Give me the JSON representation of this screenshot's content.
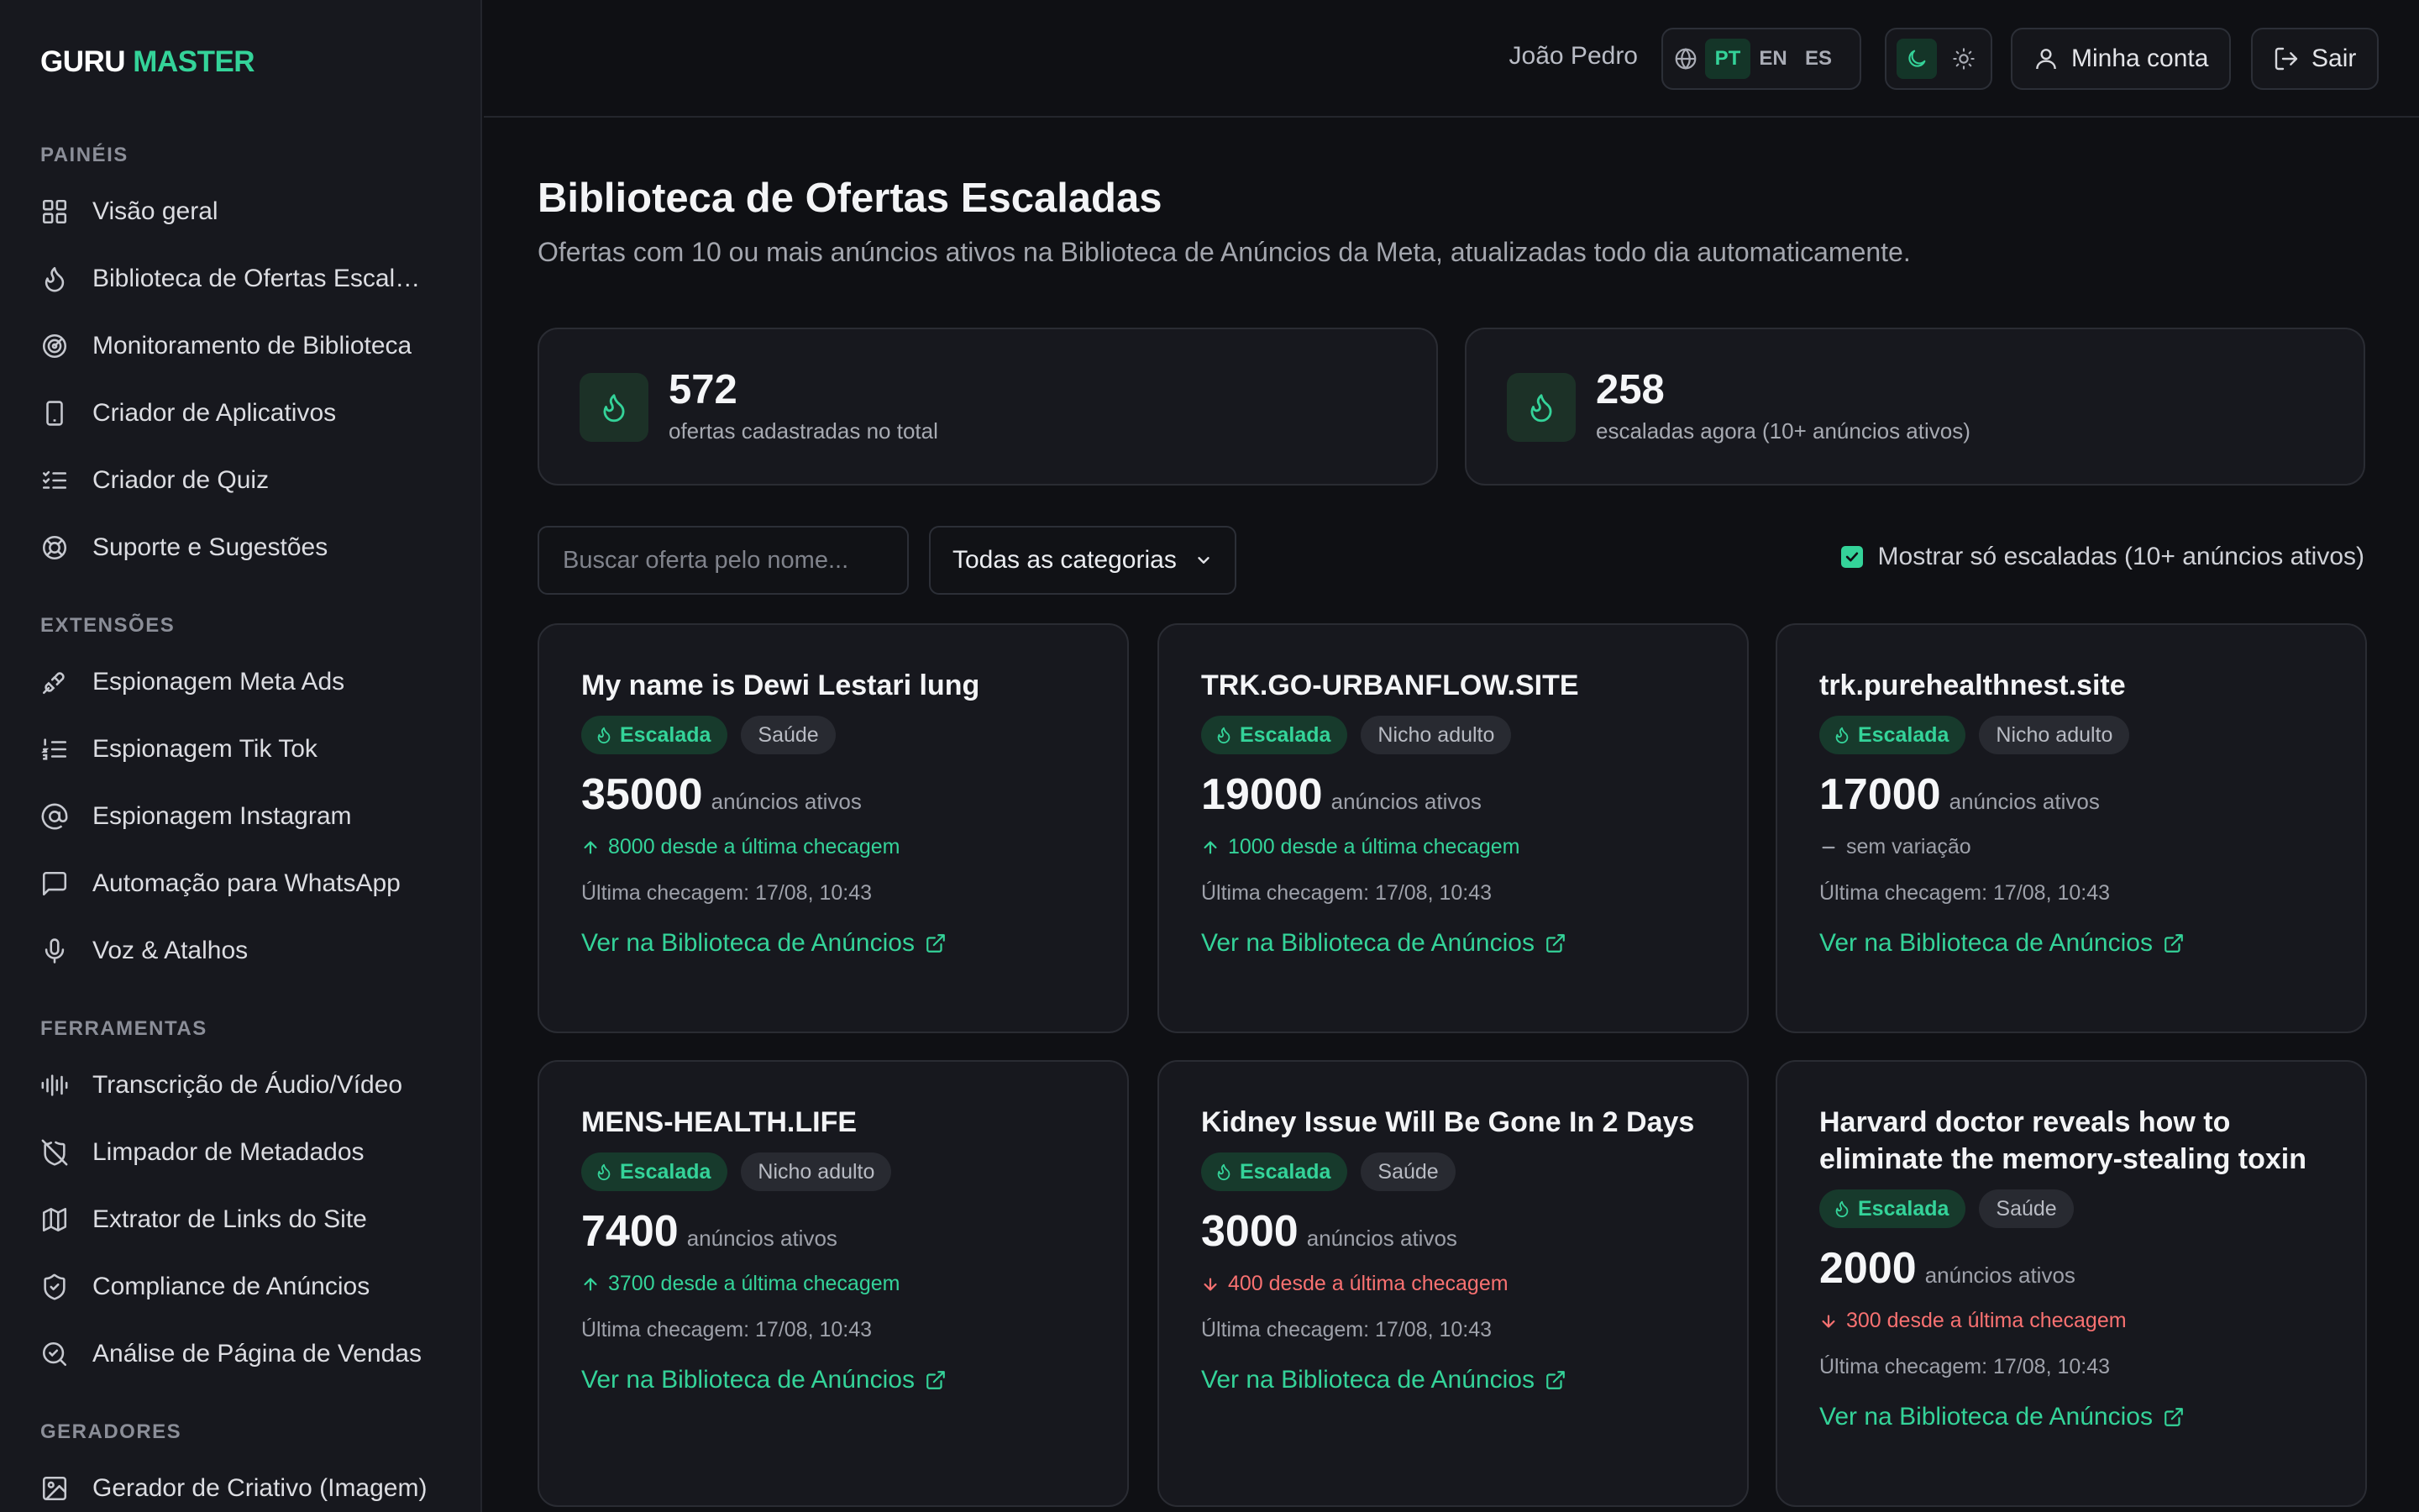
{
  "brand": {
    "part1": "GURU",
    "part2": "MASTER"
  },
  "sidebar": {
    "sections": [
      {
        "title": "PAINÉIS",
        "items": [
          {
            "label": "Visão geral",
            "icon": "grid-icon"
          },
          {
            "label": "Biblioteca de Ofertas Escaladas",
            "icon": "flame-icon"
          },
          {
            "label": "Monitoramento de Biblioteca",
            "icon": "radar-icon"
          },
          {
            "label": "Criador de Aplicativos",
            "icon": "smartphone-icon"
          },
          {
            "label": "Criador de Quiz",
            "icon": "list-checks-icon"
          },
          {
            "label": "Suporte e Sugestões",
            "icon": "lifebuoy-icon"
          }
        ]
      },
      {
        "title": "EXTENSÕES",
        "items": [
          {
            "label": "Espionagem Meta Ads",
            "icon": "plug-icon"
          },
          {
            "label": "Espionagem Tik Tok",
            "icon": "list-ordered-icon"
          },
          {
            "label": "Espionagem Instagram",
            "icon": "at-sign-icon"
          },
          {
            "label": "Automação para WhatsApp",
            "icon": "message-square-icon"
          },
          {
            "label": "Voz & Atalhos",
            "icon": "microphone-icon"
          }
        ]
      },
      {
        "title": "FERRAMENTAS",
        "items": [
          {
            "label": "Transcrição de Áudio/Vídeo",
            "icon": "audio-lines-icon"
          },
          {
            "label": "Limpador de Metadados",
            "icon": "shield-off-icon"
          },
          {
            "label": "Extrator de Links do Site",
            "icon": "map-icon"
          },
          {
            "label": "Compliance de Anúncios",
            "icon": "shield-check-icon"
          },
          {
            "label": "Análise de Página de Vendas",
            "icon": "search-check-icon"
          }
        ]
      },
      {
        "title": "GERADORES",
        "items": [
          {
            "label": "Gerador de Criativo (Imagem)",
            "icon": "image-icon"
          }
        ]
      }
    ]
  },
  "topbar": {
    "user_name": "João Pedro",
    "languages": [
      "PT",
      "EN",
      "ES"
    ],
    "active_language": "PT",
    "theme_active": "dark",
    "account_label": "Minha conta",
    "logout_label": "Sair"
  },
  "page": {
    "title": "Biblioteca de Ofertas Escaladas",
    "subtitle": "Ofertas com 10 ou mais anúncios ativos na Biblioteca de Anúncios da Meta, atualizadas todo dia automaticamente."
  },
  "stats": [
    {
      "value": "572",
      "label": "ofertas cadastradas no total"
    },
    {
      "value": "258",
      "label": "escaladas agora (10+ anúncios ativos)"
    }
  ],
  "filters": {
    "search_placeholder": "Buscar oferta pelo nome...",
    "category_selected": "Todas as categorias",
    "only_scaled_label": "Mostrar só escaladas (10+ anúncios ativos)",
    "only_scaled_checked": true
  },
  "offers": [
    {
      "title": "My name is Dewi Lestari lung",
      "badge": "Escalada",
      "category": "Saúde",
      "ads": "35000",
      "ads_label": "anúncios ativos",
      "delta_dir": "up",
      "delta_text": "8000 desde a última checagem",
      "last_check": "Última checagem: 17/08, 10:43",
      "link": "Ver na Biblioteca de Anúncios"
    },
    {
      "title": "TRK.GO-URBANFLOW.SITE",
      "badge": "Escalada",
      "category": "Nicho adulto",
      "ads": "19000",
      "ads_label": "anúncios ativos",
      "delta_dir": "up",
      "delta_text": "1000 desde a última checagem",
      "last_check": "Última checagem: 17/08, 10:43",
      "link": "Ver na Biblioteca de Anúncios"
    },
    {
      "title": "trk.purehealthnest.site",
      "badge": "Escalada",
      "category": "Nicho adulto",
      "ads": "17000",
      "ads_label": "anúncios ativos",
      "delta_dir": "flat",
      "delta_text": "sem variação",
      "last_check": "Última checagem: 17/08, 10:43",
      "link": "Ver na Biblioteca de Anúncios"
    },
    {
      "title": "MENS-HEALTH.LIFE",
      "badge": "Escalada",
      "category": "Nicho adulto",
      "ads": "7400",
      "ads_label": "anúncios ativos",
      "delta_dir": "up",
      "delta_text": "3700 desde a última checagem",
      "last_check": "Última checagem: 17/08, 10:43",
      "link": "Ver na Biblioteca de Anúncios"
    },
    {
      "title": "Kidney Issue Will Be Gone In 2 Days",
      "badge": "Escalada",
      "category": "Saúde",
      "ads": "3000",
      "ads_label": "anúncios ativos",
      "delta_dir": "down",
      "delta_text": "400 desde a última checagem",
      "last_check": "Última checagem: 17/08, 10:43",
      "link": "Ver na Biblioteca de Anúncios"
    },
    {
      "title": "Harvard doctor reveals how to eliminate the memory-stealing toxin",
      "badge": "Escalada",
      "category": "Saúde",
      "ads": "2000",
      "ads_label": "anúncios ativos",
      "delta_dir": "down",
      "delta_text": "300 desde a última checagem",
      "last_check": "Última checagem: 17/08, 10:43",
      "link": "Ver na Biblioteca de Anúncios"
    }
  ],
  "colors": {
    "accent": "#34d399",
    "negative": "#f87171",
    "background": "#0f1014",
    "card": "#17181e"
  }
}
